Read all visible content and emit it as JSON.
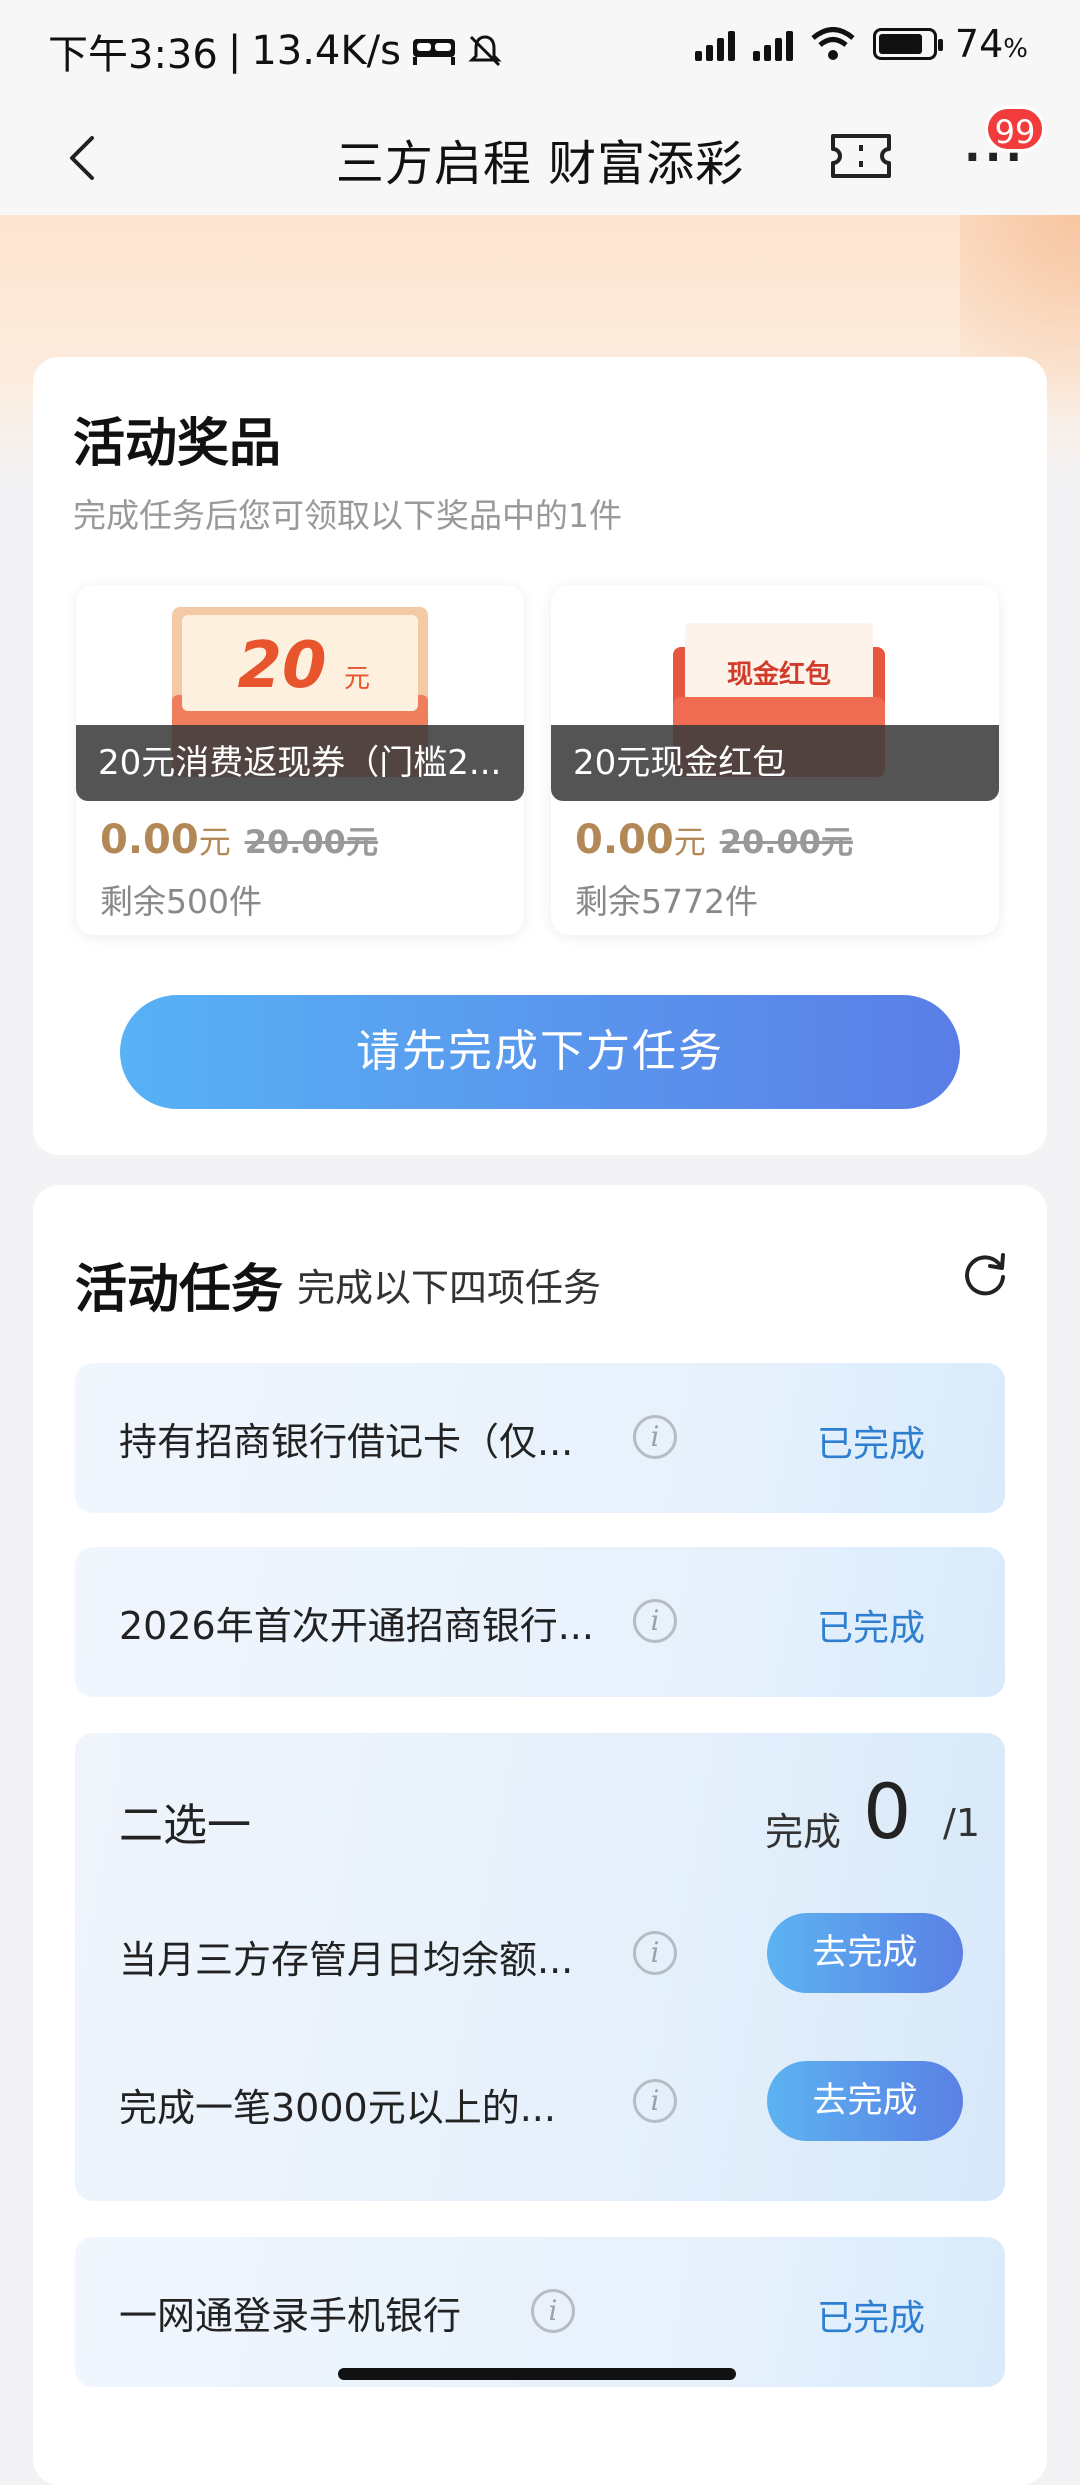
{
  "status_bar": {
    "time": "下午3:36",
    "net_speed": "13.4K/s",
    "battery": "74",
    "battery_unit": "%"
  },
  "nav": {
    "title": "三方启程 财富添彩",
    "badge_count": "99"
  },
  "prizes_section": {
    "title": "活动奖品",
    "subtitle": "完成任务后您可领取以下奖品中的1件",
    "items": [
      {
        "image_text": "20",
        "image_unit": "元",
        "label": "20元消费返现券（门槛2...",
        "price": "0.00",
        "price_unit": "元",
        "original_price": "20.00元",
        "remaining": "剩余500件"
      },
      {
        "image_text": "现金红包",
        "label": "20元现金红包",
        "price": "0.00",
        "price_unit": "元",
        "original_price": "20.00元",
        "remaining": "剩余5772件"
      }
    ],
    "action_button": "请先完成下方任务"
  },
  "tasks_section": {
    "title": "活动任务",
    "subtitle": "完成以下四项任务",
    "tasks": [
      {
        "text": "持有招商银行借记卡（仅...",
        "status": "已完成"
      },
      {
        "text": "2026年首次开通招商银行...",
        "status": "已完成"
      }
    ],
    "choice_group": {
      "title": "二选一",
      "progress_label": "完成",
      "progress_done": "0",
      "progress_total": "1",
      "options": [
        {
          "text": "当月三方存管月日均余额...",
          "button": "去完成"
        },
        {
          "text": "完成一笔3000元以上的...",
          "button": "去完成"
        }
      ]
    },
    "last_task": {
      "text": "一网通登录手机银行",
      "status": "已完成"
    }
  },
  "colors": {
    "accent_blue": "#2f7fd1",
    "button_gradient_start": "#58b2f5",
    "button_gradient_end": "#5a7ee6",
    "price_gold": "#b28956",
    "badge_red": "#f23b3b"
  }
}
